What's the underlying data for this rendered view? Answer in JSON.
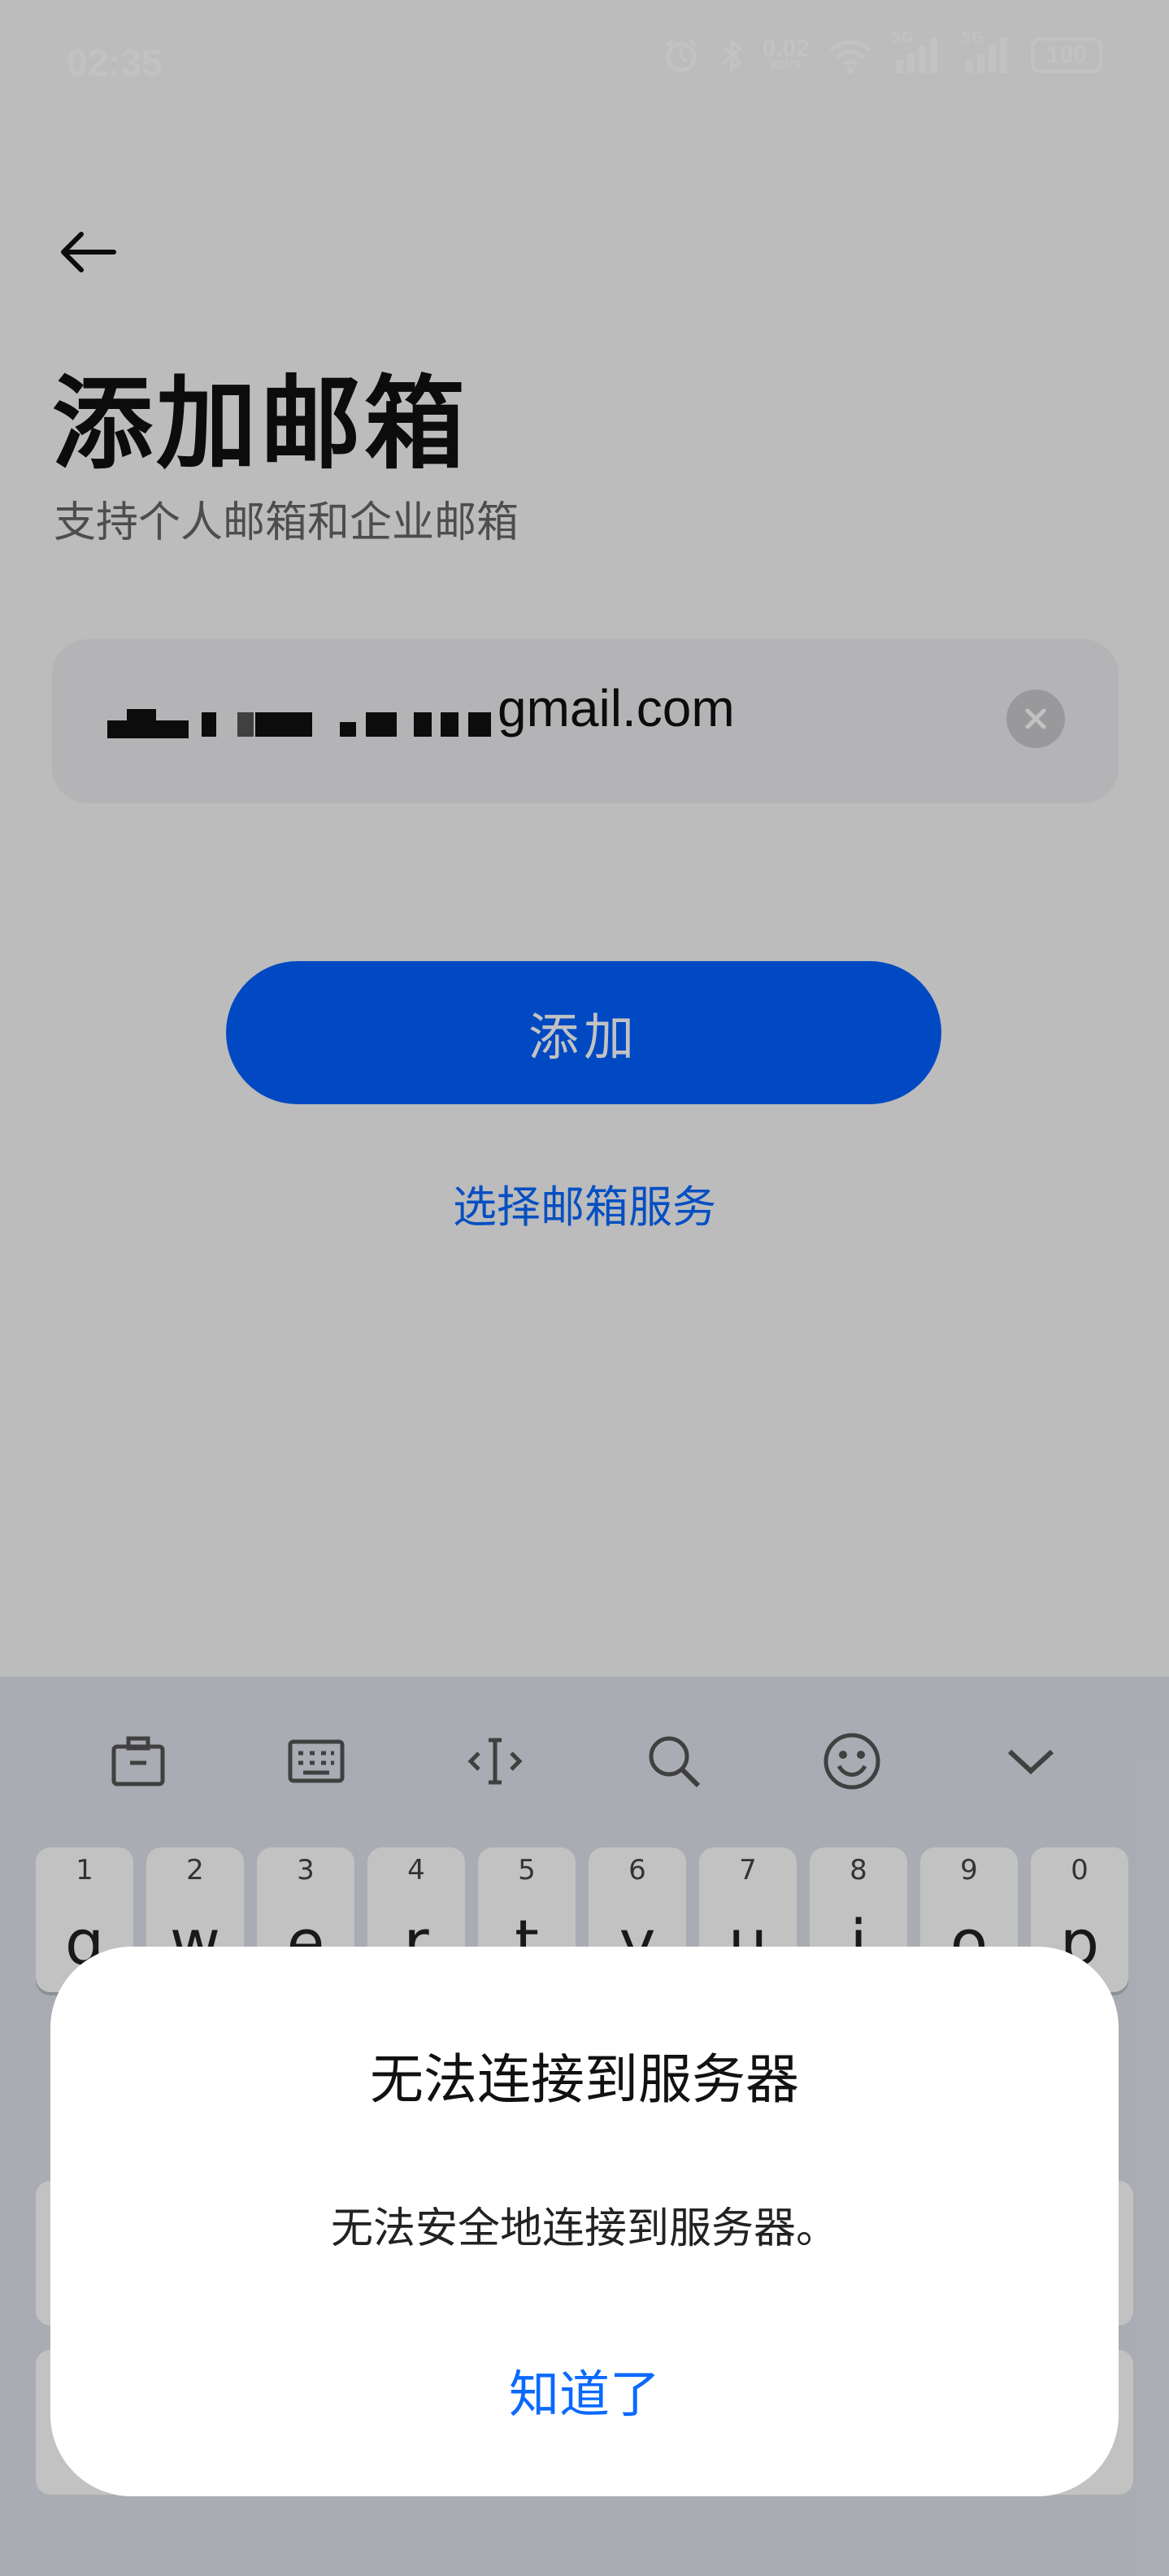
{
  "status_bar": {
    "time": "02:35",
    "network_speed": "0.02",
    "network_unit": "KB/S",
    "signal1_label": "5G",
    "signal2_label": "5G",
    "battery": "100"
  },
  "header": {
    "title": "添加邮箱",
    "subtitle": "支持个人邮箱和企业邮箱"
  },
  "email_field": {
    "value_visible_suffix": "gmail.com"
  },
  "buttons": {
    "add_label": "添加",
    "choose_service_label": "选择邮箱服务"
  },
  "keyboard": {
    "number_hints": [
      "1",
      "2",
      "3",
      "4",
      "5",
      "6",
      "7",
      "8",
      "9",
      "0"
    ],
    "letters": [
      "q",
      "w",
      "e",
      "r",
      "t",
      "y",
      "u",
      "i",
      "o",
      "p"
    ]
  },
  "dialog": {
    "title": "无法连接到服务器",
    "message": "无法安全地连接到服务器。",
    "ok_label": "知道了"
  },
  "colors": {
    "accent": "#0060ff",
    "link": "#0a69ff"
  }
}
